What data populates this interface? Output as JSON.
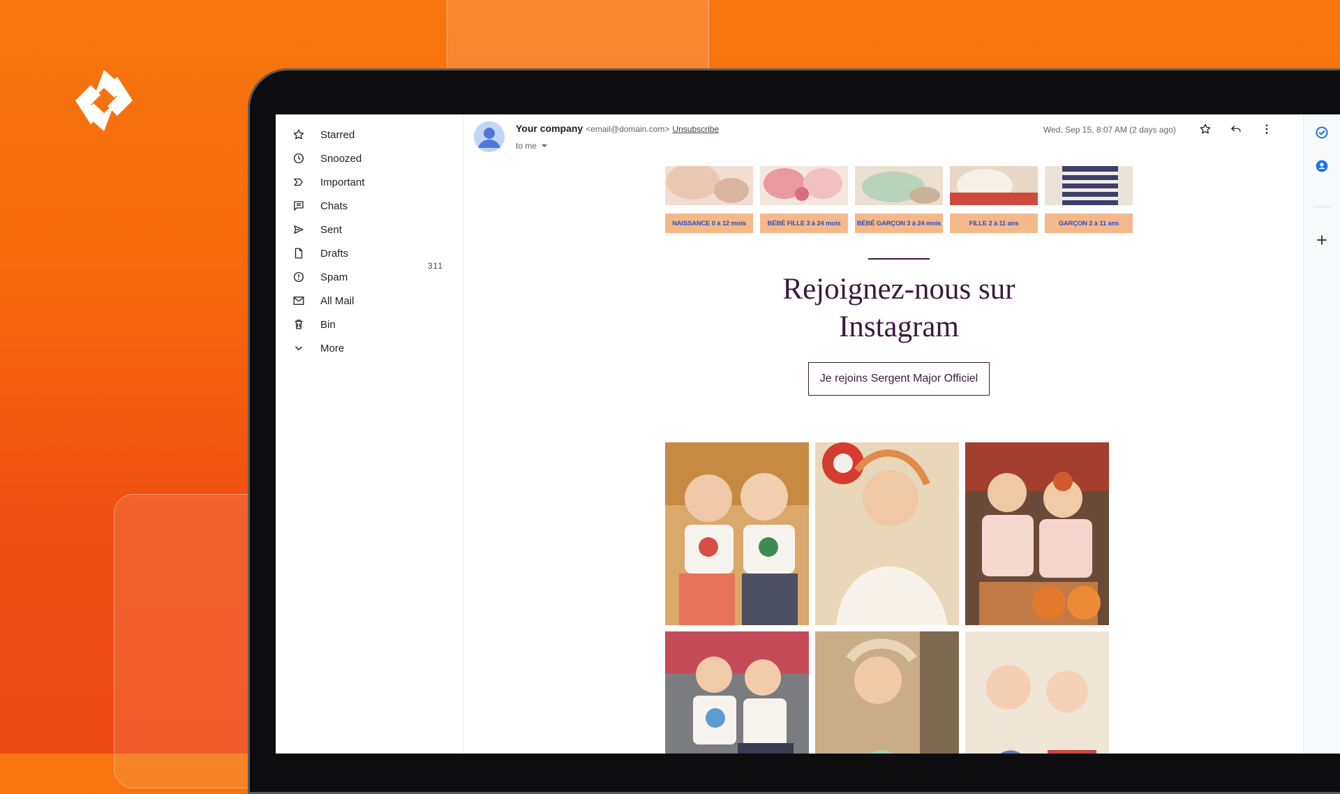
{
  "sidebar": {
    "items": [
      {
        "label": "Starred",
        "icon": "star-icon",
        "count": ""
      },
      {
        "label": "Snoozed",
        "icon": "clock-icon",
        "count": ""
      },
      {
        "label": "Important",
        "icon": "important-icon",
        "count": ""
      },
      {
        "label": "Chats",
        "icon": "chat-icon",
        "count": ""
      },
      {
        "label": "Sent",
        "icon": "send-icon",
        "count": ""
      },
      {
        "label": "Drafts",
        "icon": "draft-icon",
        "count": "311"
      },
      {
        "label": "Spam",
        "icon": "spam-icon",
        "count": ""
      },
      {
        "label": "All Mail",
        "icon": "mail-icon",
        "count": ""
      },
      {
        "label": "Bin",
        "icon": "trash-icon",
        "count": ""
      },
      {
        "label": "More",
        "icon": "chevron-down-icon",
        "count": ""
      }
    ]
  },
  "message": {
    "sender_name": "Your company",
    "sender_email": "<email@domain.com>",
    "unsubscribe": "Unsubscribe",
    "to": "to me",
    "date": "Wed, Sep 15, 8:07 AM (2 days ago)"
  },
  "email": {
    "categories": [
      "NAISSANCE 0 à 12 mois",
      "BÉBÉ FILLE 3 à 24 mois",
      "BÉBÉ GARÇON 3 à 24 mois",
      "FILLE 2 à 11 ans",
      "GARÇON 2 à 11 ans"
    ],
    "title_line1": "Rejoignez-nous sur",
    "title_line2": "Instagram",
    "cta": "Je rejoins Sergent Major Officiel"
  },
  "colors": {
    "background": "#f56a0c",
    "accent_purple": "#3b1a3d",
    "category_button": "#f4b98b",
    "category_text": "#2f4fc6"
  }
}
